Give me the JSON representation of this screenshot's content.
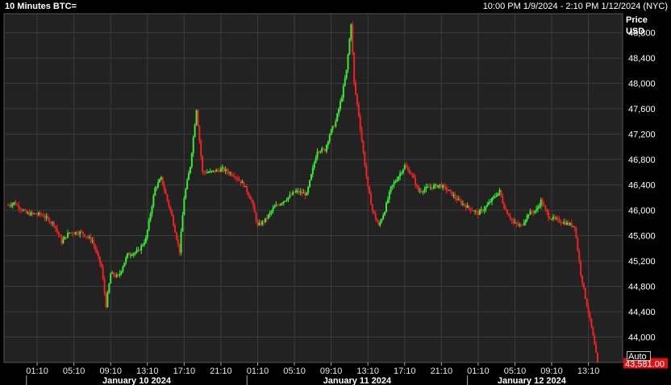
{
  "header": {
    "title": "10 Minutes BTC=",
    "range": "10:00 PM 1/9/2024 - 2:10 PM 1/12/2024 (NYC)"
  },
  "controls": {
    "auto_label": "Auto"
  },
  "colors": {
    "up": "#33ee33",
    "down": "#ee2222",
    "plot_bg": "#222222",
    "grid": "#3c3c3c",
    "last_price_bg": "#dd1111"
  },
  "chart_data": {
    "type": "candlestick",
    "title": "10 Minutes BTC=",
    "ylabel": "Price",
    "yunit": "USD",
    "ylim": [
      43600,
      49100
    ],
    "yticks": [
      44000,
      44400,
      44800,
      45200,
      45600,
      46000,
      46400,
      46800,
      47200,
      47600,
      48000,
      48400,
      48800
    ],
    "ytick_labels": [
      "44,000",
      "44,400",
      "44,800",
      "45,200",
      "45,600",
      "46,000",
      "46,400",
      "46,800",
      "47,200",
      "47,600",
      "48,000",
      "48,400",
      "48,800"
    ],
    "grid": true,
    "last_price": "43,581.00",
    "x_start": "2024-01-09 22:00",
    "x_end": "2024-01-12 14:10",
    "xticks": [
      "2024-01-10 01:10",
      "2024-01-10 05:10",
      "2024-01-10 09:10",
      "2024-01-10 13:10",
      "2024-01-10 17:10",
      "2024-01-10 21:10",
      "2024-01-11 01:10",
      "2024-01-11 05:10",
      "2024-01-11 09:10",
      "2024-01-11 13:10",
      "2024-01-11 17:10",
      "2024-01-11 21:10",
      "2024-01-12 01:10",
      "2024-01-12 05:10",
      "2024-01-12 09:10",
      "2024-01-12 13:10"
    ],
    "xtick_labels": [
      "01:10",
      "05:10",
      "09:10",
      "13:10",
      "17:10",
      "21:10",
      "01:10",
      "05:10",
      "09:10",
      "13:10",
      "17:10",
      "21:10",
      "01:10",
      "05:10",
      "09:10",
      "13:10"
    ],
    "day_labels": [
      {
        "label": "January 10 2024",
        "time": "2024-01-10 12:00"
      },
      {
        "label": "January 11 2024",
        "time": "2024-01-11 12:00"
      },
      {
        "label": "January 12 2024",
        "time": "2024-01-12 07:00"
      }
    ],
    "day_separators": [
      "2024-01-10 00:00",
      "2024-01-11 00:00",
      "2024-01-12 00:00"
    ],
    "close_path": [
      [
        "2024-01-09 22:00",
        46080
      ],
      [
        "2024-01-09 22:40",
        46120
      ],
      [
        "2024-01-10 00:00",
        45950
      ],
      [
        "2024-01-10 01:40",
        45930
      ],
      [
        "2024-01-10 03:00",
        45780
      ],
      [
        "2024-01-10 03:50",
        45500
      ],
      [
        "2024-01-10 04:40",
        45650
      ],
      [
        "2024-01-10 06:00",
        45650
      ],
      [
        "2024-01-10 07:10",
        45520
      ],
      [
        "2024-01-10 08:10",
        45100
      ],
      [
        "2024-01-10 08:40",
        44500
      ],
      [
        "2024-01-10 09:10",
        45000
      ],
      [
        "2024-01-10 10:00",
        44950
      ],
      [
        "2024-01-10 11:00",
        45300
      ],
      [
        "2024-01-10 12:10",
        45350
      ],
      [
        "2024-01-10 13:00",
        45550
      ],
      [
        "2024-01-10 14:00",
        46350
      ],
      [
        "2024-01-10 14:40",
        46500
      ],
      [
        "2024-01-10 15:50",
        45900
      ],
      [
        "2024-01-10 16:40",
        45350
      ],
      [
        "2024-01-10 17:10",
        46200
      ],
      [
        "2024-01-10 17:50",
        46700
      ],
      [
        "2024-01-10 18:30",
        47600
      ],
      [
        "2024-01-10 19:10",
        46600
      ],
      [
        "2024-01-10 20:00",
        46600
      ],
      [
        "2024-01-10 21:20",
        46650
      ],
      [
        "2024-01-10 22:40",
        46550
      ],
      [
        "2024-01-10 23:40",
        46400
      ],
      [
        "2024-01-11 00:30",
        46150
      ],
      [
        "2024-01-11 01:10",
        45750
      ],
      [
        "2024-01-11 02:00",
        45850
      ],
      [
        "2024-01-11 03:00",
        46050
      ],
      [
        "2024-01-11 04:00",
        46150
      ],
      [
        "2024-01-11 05:20",
        46300
      ],
      [
        "2024-01-11 06:30",
        46250
      ],
      [
        "2024-01-11 07:40",
        46950
      ],
      [
        "2024-01-11 08:30",
        46950
      ],
      [
        "2024-01-11 09:00",
        47200
      ],
      [
        "2024-01-11 09:40",
        47400
      ],
      [
        "2024-01-11 10:20",
        47800
      ],
      [
        "2024-01-11 10:50",
        48200
      ],
      [
        "2024-01-11 11:20",
        48950
      ],
      [
        "2024-01-11 11:40",
        48000
      ],
      [
        "2024-01-11 12:10",
        47500
      ],
      [
        "2024-01-11 12:40",
        46900
      ],
      [
        "2024-01-11 13:10",
        46350
      ],
      [
        "2024-01-11 13:40",
        46000
      ],
      [
        "2024-01-11 14:20",
        45750
      ],
      [
        "2024-01-11 15:00",
        46000
      ],
      [
        "2024-01-11 15:40",
        46350
      ],
      [
        "2024-01-11 16:20",
        46500
      ],
      [
        "2024-01-11 17:10",
        46700
      ],
      [
        "2024-01-11 18:00",
        46550
      ],
      [
        "2024-01-11 18:40",
        46300
      ],
      [
        "2024-01-11 19:40",
        46350
      ],
      [
        "2024-01-11 21:00",
        46400
      ],
      [
        "2024-01-11 22:00",
        46300
      ],
      [
        "2024-01-11 23:00",
        46150
      ],
      [
        "2024-01-12 00:00",
        46050
      ],
      [
        "2024-01-12 01:10",
        45950
      ],
      [
        "2024-01-12 02:00",
        46050
      ],
      [
        "2024-01-12 02:50",
        46200
      ],
      [
        "2024-01-12 03:30",
        46300
      ],
      [
        "2024-01-12 04:00",
        46050
      ],
      [
        "2024-01-12 05:00",
        45800
      ],
      [
        "2024-01-12 05:50",
        45750
      ],
      [
        "2024-01-12 06:40",
        45950
      ],
      [
        "2024-01-12 07:30",
        46000
      ],
      [
        "2024-01-12 08:00",
        46150
      ],
      [
        "2024-01-12 08:50",
        45900
      ],
      [
        "2024-01-12 09:40",
        45850
      ],
      [
        "2024-01-12 10:40",
        45800
      ],
      [
        "2024-01-12 11:40",
        45750
      ],
      [
        "2024-01-12 12:20",
        45000
      ],
      [
        "2024-01-12 13:00",
        44500
      ],
      [
        "2024-01-12 13:30",
        44150
      ],
      [
        "2024-01-12 14:10",
        43581
      ]
    ]
  }
}
